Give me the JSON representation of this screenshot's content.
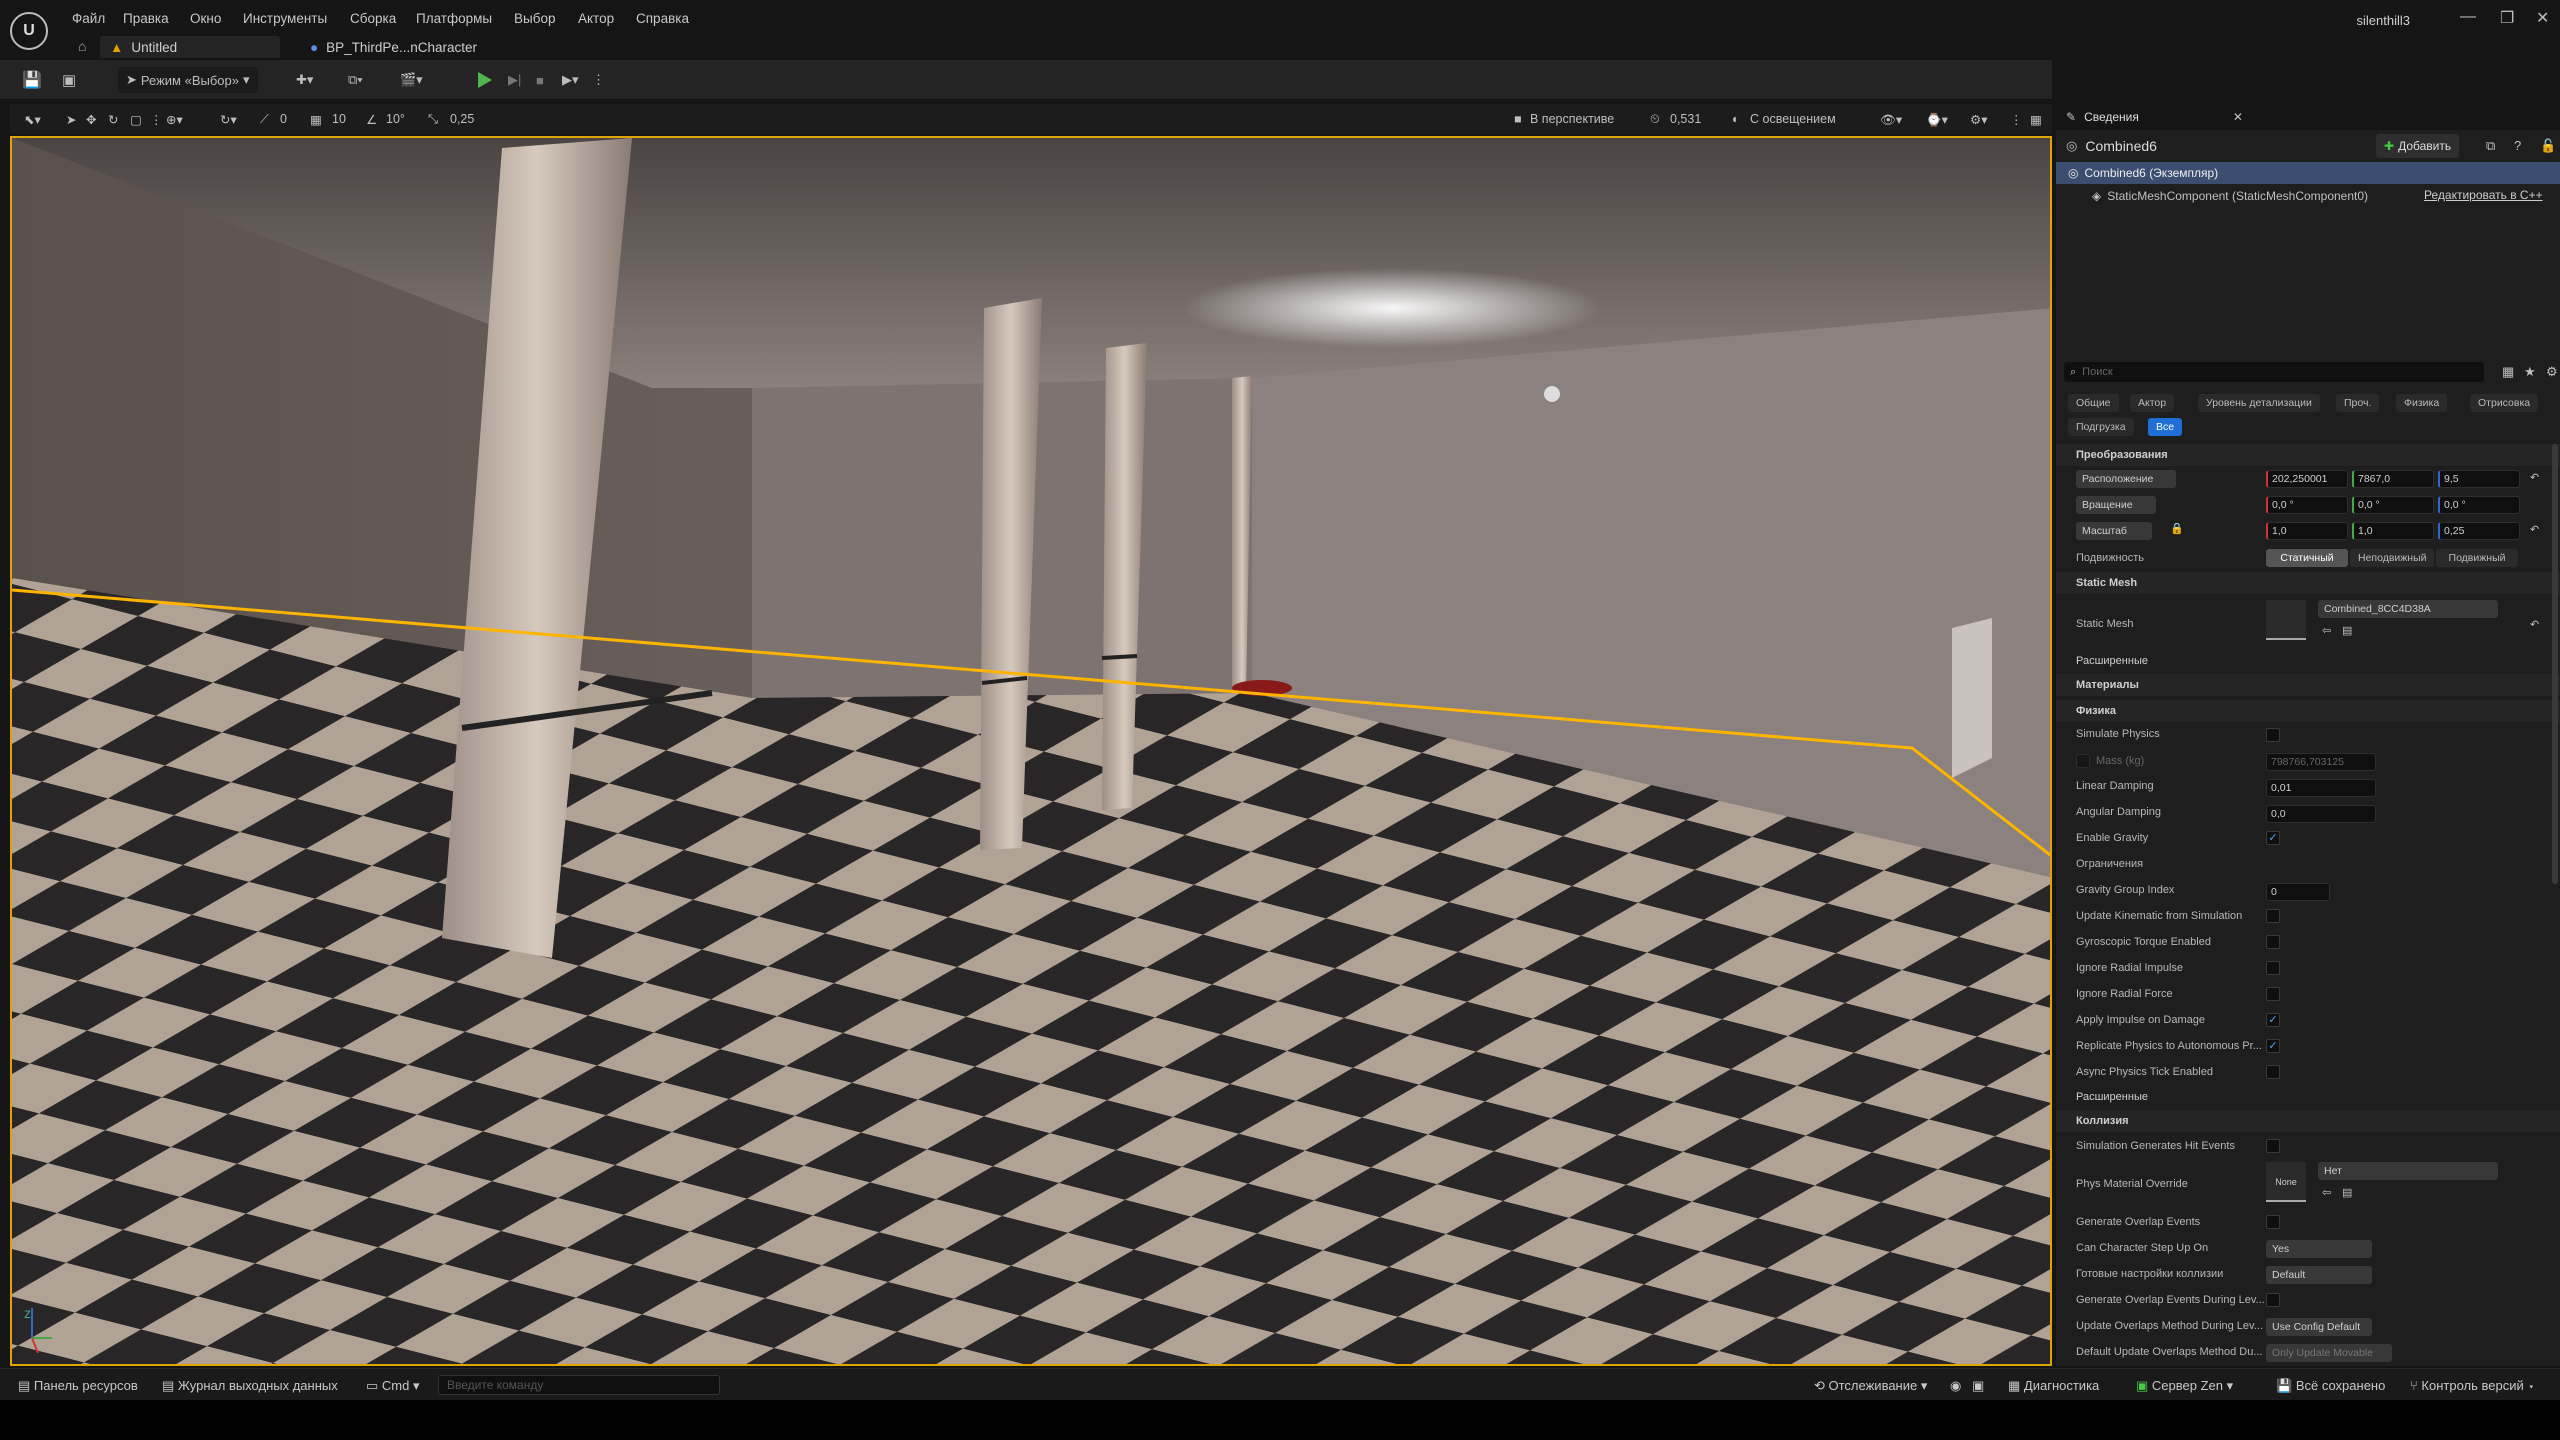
{
  "menu": [
    "Файл",
    "Правка",
    "Окно",
    "Инструменты",
    "Сборка",
    "Платформы",
    "Выбор",
    "Актор",
    "Справка"
  ],
  "window": {
    "user": "silenthill3"
  },
  "tabs": {
    "level": "Untitled",
    "blueprint": "BP_ThirdPe...nCharacter"
  },
  "toolbar": {
    "mode": "Режим «Выбор»"
  },
  "viewport_toolbar": {
    "rot_snap": "0",
    "grid_snap": "10",
    "angle_snap": "10°",
    "scale_snap": "0,25",
    "perspective": "В перспективе",
    "camera_speed": "0,531",
    "lighting": "С освещением"
  },
  "details": {
    "tab_title": "Сведения",
    "actor_name": "Combined6",
    "add_button": "Добавить",
    "instance_label": "Combined6 (Экземпляр)",
    "component_label": "StaticMeshComponent (StaticMeshComponent0)",
    "edit_cpp": "Редактировать в C++",
    "search_placeholder": "Поиск",
    "filters": [
      "Общие",
      "Актор",
      "Уровень детализации",
      "Проч.",
      "Физика",
      "Отрисовка",
      "Подгрузка",
      "Все"
    ],
    "transform": {
      "section": "Преобразования",
      "location_label": "Расположение",
      "rotation_label": "Вращение",
      "scale_label": "Масштаб",
      "location": [
        "202,250001",
        "7867,0",
        "9,5"
      ],
      "rotation": [
        "0,0 °",
        "0,0 °",
        "0,0 °"
      ],
      "scale": [
        "1,0",
        "1,0",
        "0,25"
      ],
      "mobility_label": "Подвижность",
      "mobility": [
        "Статичный",
        "Неподвижный",
        "Подвижный"
      ]
    },
    "static_mesh": {
      "section": "Static Mesh",
      "label": "Static Mesh",
      "value": "Combined_8CC4D38A"
    },
    "advanced": "Расширенные",
    "materials": "Материалы",
    "physics": {
      "section": "Физика",
      "simulate_physics": "Simulate Physics",
      "mass_label": "Mass (kg)",
      "mass_value": "798766,703125",
      "linear_damping": "Linear Damping",
      "linear_damping_value": "0,01",
      "angular_damping": "Angular Damping",
      "angular_damping_value": "0,0",
      "enable_gravity": "Enable Gravity",
      "constraints": "Ограничения",
      "gravity_group": "Gravity Group Index",
      "gravity_group_value": "0",
      "update_kinematic": "Update Kinematic from Simulation",
      "gyroscopic": "Gyroscopic Torque Enabled",
      "ignore_impulse": "Ignore Radial Impulse",
      "ignore_force": "Ignore Radial Force",
      "apply_impulse": "Apply Impulse on Damage",
      "replicate": "Replicate Physics to Autonomous Pr...",
      "async_tick": "Async Physics Tick Enabled"
    },
    "advanced2": "Расширенные",
    "collision": {
      "section": "Коллизия",
      "sim_hit": "Simulation Generates Hit Events",
      "phys_mat": "Phys Material Override",
      "phys_mat_thumb": "None",
      "phys_mat_value": "Нет",
      "gen_overlap": "Generate Overlap Events",
      "step_up": "Can Character Step Up On",
      "step_up_value": "Yes",
      "presets": "Готовые настройки коллизии",
      "presets_value": "Default",
      "gen_overlap_level": "Generate Overlap Events During Lev...",
      "update_method": "Update Overlaps Method During Lev...",
      "update_method_value": "Use Config Default",
      "default_update": "Default Update Overlaps Method Du...",
      "default_update_value": "Only Update Movable"
    }
  },
  "status": {
    "content": "Панель ресурсов",
    "log": "Журнал выходных данных",
    "cmd": "Cmd",
    "cmd_placeholder": "Введите команду",
    "trace": "Отслеживание",
    "diag": "Диагностика",
    "zen": "Сервер Zen",
    "saved": "Всё сохранено",
    "vcs": "Контроль версий"
  }
}
